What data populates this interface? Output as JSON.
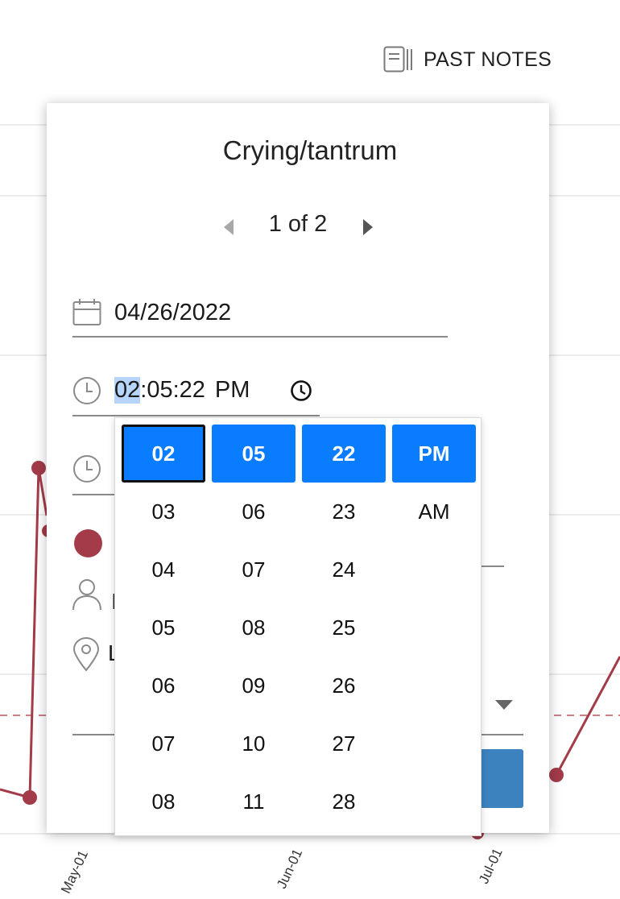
{
  "header": {
    "past_notes_label": "PAST NOTES"
  },
  "modal": {
    "title": "Crying/tantrum",
    "pager": {
      "text": "1 of 2"
    },
    "date_value": "04/26/2022",
    "time": {
      "hour": "02",
      "minute": "05",
      "second": "22",
      "period": "PM​",
      "sep": ":"
    },
    "cut_labels": {
      "person": "I",
      "location": "L"
    }
  },
  "time_picker": {
    "hours": [
      "02",
      "03",
      "04",
      "05",
      "06",
      "07",
      "08"
    ],
    "minutes": [
      "05",
      "06",
      "07",
      "08",
      "09",
      "10",
      "11"
    ],
    "seconds": [
      "22",
      "23",
      "24",
      "25",
      "26",
      "27",
      "28"
    ],
    "periods": [
      "PM",
      "AM"
    ]
  },
  "background_chart": {
    "x_ticks": [
      "May-01",
      "Jun-01",
      "Jul-01"
    ],
    "line_color": "#a33b49",
    "threshold_color": "#c0505f"
  }
}
